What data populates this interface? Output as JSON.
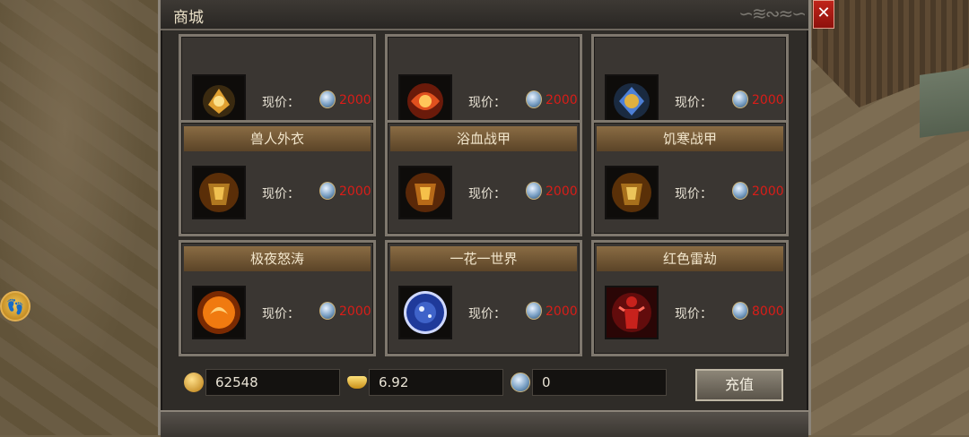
{
  "window": {
    "title": "商城",
    "close_icon": "close-icon",
    "close_symbol": "✕"
  },
  "items": [
    {
      "name": "",
      "price_label": "现价：",
      "price": "2000",
      "icon": "gold-amulet",
      "color": "#e0a030"
    },
    {
      "name": "",
      "price_label": "现价：",
      "price": "2000",
      "icon": "fire-amulet",
      "color": "#e0501e"
    },
    {
      "name": "",
      "price_label": "现价：",
      "price": "2000",
      "icon": "blue-gold-amulet",
      "color": "#4d7fd6"
    },
    {
      "name": "兽人外衣",
      "price_label": "现价：",
      "price": "2000",
      "icon": "orc-armor",
      "color": "#d98b1c"
    },
    {
      "name": "浴血战甲",
      "price_label": "现价：",
      "price": "2000",
      "icon": "bloodbath-armor",
      "color": "#d98b1c"
    },
    {
      "name": "饥寒战甲",
      "price_label": "现价：",
      "price": "2000",
      "icon": "frost-armor",
      "color": "#d98b1c"
    },
    {
      "name": "极夜怒涛",
      "price_label": "现价：",
      "price": "2000",
      "icon": "fire-orb",
      "color": "#f07a10"
    },
    {
      "name": "一花一世界",
      "price_label": "现价：",
      "price": "2000",
      "icon": "blue-orb",
      "color": "#3f63c9"
    },
    {
      "name": "红色雷劫",
      "price_label": "现价：",
      "price": "8000",
      "icon": "red-thunder-figure",
      "color": "#c8221c"
    }
  ],
  "currency": {
    "gold": {
      "value": "62548",
      "icon": "gold-coin-icon"
    },
    "ingot": {
      "value": "6.92",
      "icon": "gold-ingot-icon"
    },
    "gem": {
      "value": "0",
      "icon": "gem-icon"
    }
  },
  "recharge_label": "充值",
  "npc_icon": "footprint-icon"
}
